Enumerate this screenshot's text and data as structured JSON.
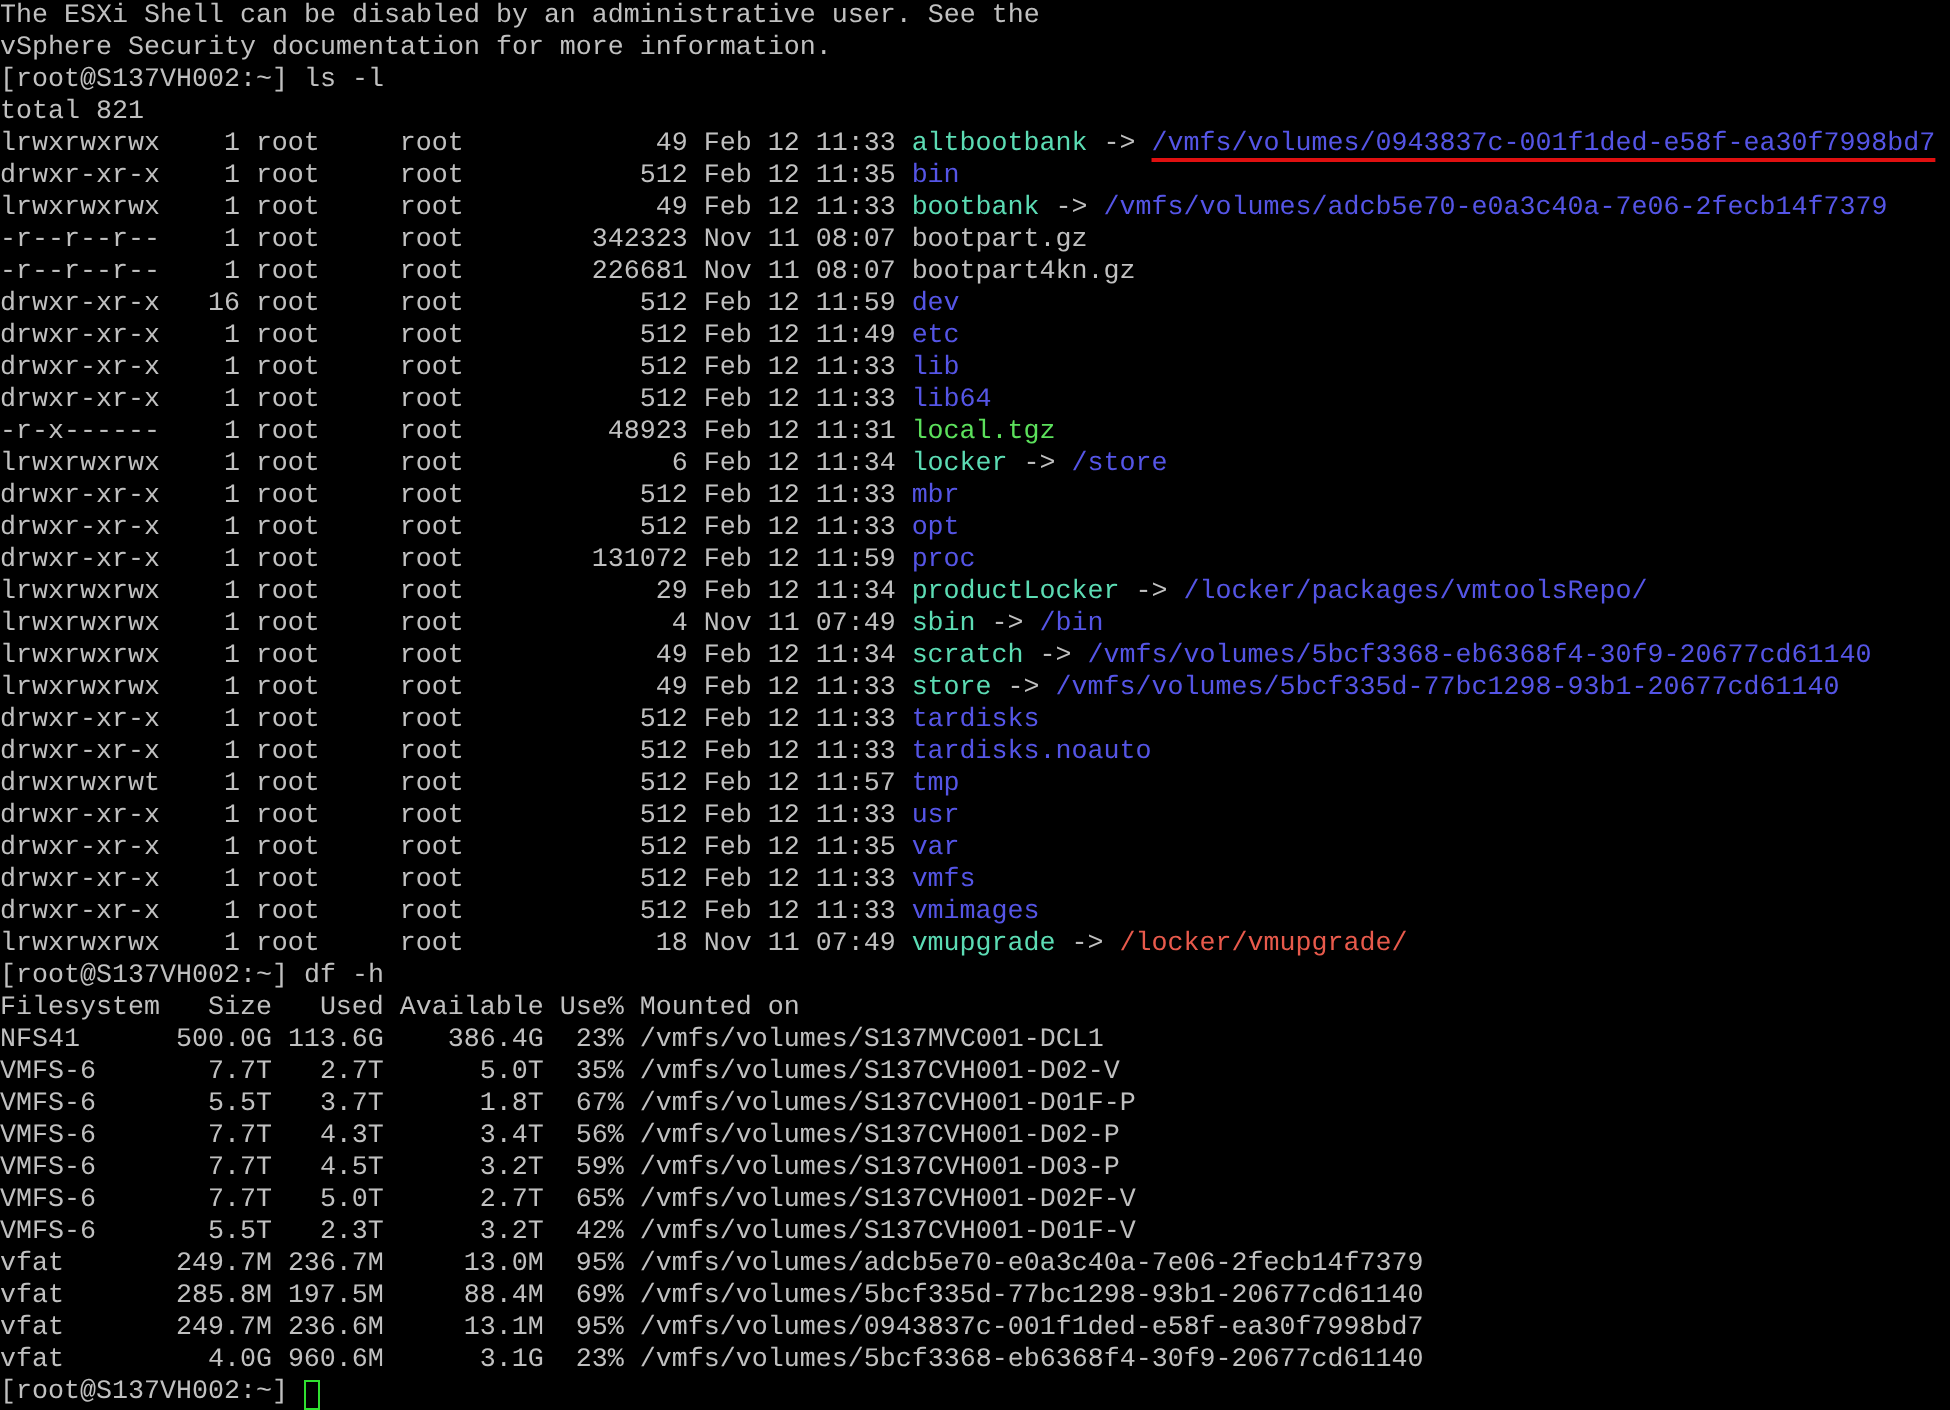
{
  "lines": [
    {
      "kind": "text",
      "text": "The ESXi Shell can be disabled by an administrative user. See the"
    },
    {
      "kind": "text",
      "text": "vSphere Security documentation for more information."
    },
    {
      "kind": "prompt",
      "prompt": "[root@S137VH002:~]",
      "command": "ls -l",
      "cursor": false
    },
    {
      "kind": "text",
      "text": "total 821"
    },
    {
      "kind": "entry",
      "perms": "lrwxrwxrwx",
      "links": "1",
      "owner": "root",
      "group": "root",
      "size": "49",
      "date": "Feb 12 11:33",
      "name": {
        "text": "altbootbank",
        "color": "#5cdcb4"
      },
      "arrow": "->",
      "target": {
        "text": "/vmfs/volumes/0943837c-001f1ded-e58f-ea30f7998bd7",
        "color": "#5555e6"
      },
      "underlined": true
    },
    {
      "kind": "entry",
      "perms": "drwxr-xr-x",
      "links": "1",
      "owner": "root",
      "group": "root",
      "size": "512",
      "date": "Feb 12 11:35",
      "name": {
        "text": "bin",
        "color": "#5555e6"
      }
    },
    {
      "kind": "entry",
      "perms": "lrwxrwxrwx",
      "links": "1",
      "owner": "root",
      "group": "root",
      "size": "49",
      "date": "Feb 12 11:33",
      "name": {
        "text": "bootbank",
        "color": "#5cdcb4"
      },
      "arrow": "->",
      "target": {
        "text": "/vmfs/volumes/adcb5e70-e0a3c40a-7e06-2fecb14f7379",
        "color": "#5555e6"
      },
      "underlined": false
    },
    {
      "kind": "entry",
      "perms": "-r--r--r--",
      "links": "1",
      "owner": "root",
      "group": "root",
      "size": "342323",
      "date": "Nov 11 08:07",
      "name": {
        "text": "bootpart.gz",
        "color": "#c0c0c0"
      }
    },
    {
      "kind": "entry",
      "perms": "-r--r--r--",
      "links": "1",
      "owner": "root",
      "group": "root",
      "size": "226681",
      "date": "Nov 11 08:07",
      "name": {
        "text": "bootpart4kn.gz",
        "color": "#c0c0c0"
      }
    },
    {
      "kind": "entry",
      "perms": "drwxr-xr-x",
      "links": "16",
      "owner": "root",
      "group": "root",
      "size": "512",
      "date": "Feb 12 11:59",
      "name": {
        "text": "dev",
        "color": "#5555e6"
      }
    },
    {
      "kind": "entry",
      "perms": "drwxr-xr-x",
      "links": "1",
      "owner": "root",
      "group": "root",
      "size": "512",
      "date": "Feb 12 11:49",
      "name": {
        "text": "etc",
        "color": "#5555e6"
      }
    },
    {
      "kind": "entry",
      "perms": "drwxr-xr-x",
      "links": "1",
      "owner": "root",
      "group": "root",
      "size": "512",
      "date": "Feb 12 11:33",
      "name": {
        "text": "lib",
        "color": "#5555e6"
      }
    },
    {
      "kind": "entry",
      "perms": "drwxr-xr-x",
      "links": "1",
      "owner": "root",
      "group": "root",
      "size": "512",
      "date": "Feb 12 11:33",
      "name": {
        "text": "lib64",
        "color": "#5555e6"
      }
    },
    {
      "kind": "entry",
      "perms": "-r-x------",
      "links": "1",
      "owner": "root",
      "group": "root",
      "size": "48923",
      "date": "Feb 12 11:31",
      "name": {
        "text": "local.tgz",
        "color": "#5ce05c"
      }
    },
    {
      "kind": "entry",
      "perms": "lrwxrwxrwx",
      "links": "1",
      "owner": "root",
      "group": "root",
      "size": "6",
      "date": "Feb 12 11:34",
      "name": {
        "text": "locker",
        "color": "#5cdcb4"
      },
      "arrow": "->",
      "target": {
        "text": "/store",
        "color": "#5555e6"
      },
      "underlined": false
    },
    {
      "kind": "entry",
      "perms": "drwxr-xr-x",
      "links": "1",
      "owner": "root",
      "group": "root",
      "size": "512",
      "date": "Feb 12 11:33",
      "name": {
        "text": "mbr",
        "color": "#5555e6"
      }
    },
    {
      "kind": "entry",
      "perms": "drwxr-xr-x",
      "links": "1",
      "owner": "root",
      "group": "root",
      "size": "512",
      "date": "Feb 12 11:33",
      "name": {
        "text": "opt",
        "color": "#5555e6"
      }
    },
    {
      "kind": "entry",
      "perms": "drwxr-xr-x",
      "links": "1",
      "owner": "root",
      "group": "root",
      "size": "131072",
      "date": "Feb 12 11:59",
      "name": {
        "text": "proc",
        "color": "#5555e6"
      }
    },
    {
      "kind": "entry",
      "perms": "lrwxrwxrwx",
      "links": "1",
      "owner": "root",
      "group": "root",
      "size": "29",
      "date": "Feb 12 11:34",
      "name": {
        "text": "productLocker",
        "color": "#5cdcb4"
      },
      "arrow": "->",
      "target": {
        "text": "/locker/packages/vmtoolsRepo/",
        "color": "#5555e6"
      },
      "underlined": false
    },
    {
      "kind": "entry",
      "perms": "lrwxrwxrwx",
      "links": "1",
      "owner": "root",
      "group": "root",
      "size": "4",
      "date": "Nov 11 07:49",
      "name": {
        "text": "sbin",
        "color": "#5cdcb4"
      },
      "arrow": "->",
      "target": {
        "text": "/bin",
        "color": "#5555e6"
      },
      "underlined": false
    },
    {
      "kind": "entry",
      "perms": "lrwxrwxrwx",
      "links": "1",
      "owner": "root",
      "group": "root",
      "size": "49",
      "date": "Feb 12 11:34",
      "name": {
        "text": "scratch",
        "color": "#5cdcb4"
      },
      "arrow": "->",
      "target": {
        "text": "/vmfs/volumes/5bcf3368-eb6368f4-30f9-20677cd61140",
        "color": "#5555e6"
      },
      "underlined": false
    },
    {
      "kind": "entry",
      "perms": "lrwxrwxrwx",
      "links": "1",
      "owner": "root",
      "group": "root",
      "size": "49",
      "date": "Feb 12 11:33",
      "name": {
        "text": "store",
        "color": "#5cdcb4"
      },
      "arrow": "->",
      "target": {
        "text": "/vmfs/volumes/5bcf335d-77bc1298-93b1-20677cd61140",
        "color": "#5555e6"
      },
      "underlined": false
    },
    {
      "kind": "entry",
      "perms": "drwxr-xr-x",
      "links": "1",
      "owner": "root",
      "group": "root",
      "size": "512",
      "date": "Feb 12 11:33",
      "name": {
        "text": "tardisks",
        "color": "#5555e6"
      }
    },
    {
      "kind": "entry",
      "perms": "drwxr-xr-x",
      "links": "1",
      "owner": "root",
      "group": "root",
      "size": "512",
      "date": "Feb 12 11:33",
      "name": {
        "text": "tardisks.noauto",
        "color": "#5555e6"
      }
    },
    {
      "kind": "entry",
      "perms": "drwxrwxrwt",
      "links": "1",
      "owner": "root",
      "group": "root",
      "size": "512",
      "date": "Feb 12 11:57",
      "name": {
        "text": "tmp",
        "color": "#5555e6"
      }
    },
    {
      "kind": "entry",
      "perms": "drwxr-xr-x",
      "links": "1",
      "owner": "root",
      "group": "root",
      "size": "512",
      "date": "Feb 12 11:33",
      "name": {
        "text": "usr",
        "color": "#5555e6"
      }
    },
    {
      "kind": "entry",
      "perms": "drwxr-xr-x",
      "links": "1",
      "owner": "root",
      "group": "root",
      "size": "512",
      "date": "Feb 12 11:35",
      "name": {
        "text": "var",
        "color": "#5555e6"
      }
    },
    {
      "kind": "entry",
      "perms": "drwxr-xr-x",
      "links": "1",
      "owner": "root",
      "group": "root",
      "size": "512",
      "date": "Feb 12 11:33",
      "name": {
        "text": "vmfs",
        "color": "#5555e6"
      }
    },
    {
      "kind": "entry",
      "perms": "drwxr-xr-x",
      "links": "1",
      "owner": "root",
      "group": "root",
      "size": "512",
      "date": "Feb 12 11:33",
      "name": {
        "text": "vmimages",
        "color": "#5555e6"
      }
    },
    {
      "kind": "entry",
      "perms": "lrwxrwxrwx",
      "links": "1",
      "owner": "root",
      "group": "root",
      "size": "18",
      "date": "Nov 11 07:49",
      "name": {
        "text": "vmupgrade",
        "color": "#5cdcb4"
      },
      "arrow": "->",
      "target": {
        "text": "/locker/vmupgrade/",
        "color": "#e85a4c"
      },
      "underlined": false
    },
    {
      "kind": "prompt",
      "prompt": "[root@S137VH002:~]",
      "command": "df -h",
      "cursor": false
    },
    {
      "kind": "df",
      "filesystem": "Filesystem",
      "size": "Size",
      "used": "Used",
      "available": "Available",
      "use": "Use%",
      "mount": "Mounted on"
    },
    {
      "kind": "df",
      "filesystem": "NFS41",
      "size": "500.0G",
      "used": "113.6G",
      "available": "386.4G",
      "use": "23%",
      "mount": "/vmfs/volumes/S137MVC001-DCL1"
    },
    {
      "kind": "df",
      "filesystem": "VMFS-6",
      "size": "7.7T",
      "used": "2.7T",
      "available": "5.0T",
      "use": "35%",
      "mount": "/vmfs/volumes/S137CVH001-D02-V"
    },
    {
      "kind": "df",
      "filesystem": "VMFS-6",
      "size": "5.5T",
      "used": "3.7T",
      "available": "1.8T",
      "use": "67%",
      "mount": "/vmfs/volumes/S137CVH001-D01F-P"
    },
    {
      "kind": "df",
      "filesystem": "VMFS-6",
      "size": "7.7T",
      "used": "4.3T",
      "available": "3.4T",
      "use": "56%",
      "mount": "/vmfs/volumes/S137CVH001-D02-P"
    },
    {
      "kind": "df",
      "filesystem": "VMFS-6",
      "size": "7.7T",
      "used": "4.5T",
      "available": "3.2T",
      "use": "59%",
      "mount": "/vmfs/volumes/S137CVH001-D03-P"
    },
    {
      "kind": "df",
      "filesystem": "VMFS-6",
      "size": "7.7T",
      "used": "5.0T",
      "available": "2.7T",
      "use": "65%",
      "mount": "/vmfs/volumes/S137CVH001-D02F-V"
    },
    {
      "kind": "df",
      "filesystem": "VMFS-6",
      "size": "5.5T",
      "used": "2.3T",
      "available": "3.2T",
      "use": "42%",
      "mount": "/vmfs/volumes/S137CVH001-D01F-V"
    },
    {
      "kind": "df",
      "filesystem": "vfat",
      "size": "249.7M",
      "used": "236.7M",
      "available": "13.0M",
      "use": "95%",
      "mount": "/vmfs/volumes/adcb5e70-e0a3c40a-7e06-2fecb14f7379"
    },
    {
      "kind": "df",
      "filesystem": "vfat",
      "size": "285.8M",
      "used": "197.5M",
      "available": "88.4M",
      "use": "69%",
      "mount": "/vmfs/volumes/5bcf335d-77bc1298-93b1-20677cd61140"
    },
    {
      "kind": "df",
      "filesystem": "vfat",
      "size": "249.7M",
      "used": "236.6M",
      "available": "13.1M",
      "use": "95%",
      "mount": "/vmfs/volumes/0943837c-001f1ded-e58f-ea30f7998bd7"
    },
    {
      "kind": "df",
      "filesystem": "vfat",
      "size": "4.0G",
      "used": "960.6M",
      "available": "3.1G",
      "use": "23%",
      "mount": "/vmfs/volumes/5bcf3368-eb6368f4-30f9-20677cd61140"
    },
    {
      "kind": "prompt",
      "prompt": "[root@S137VH002:~]",
      "cursor": true
    }
  ]
}
